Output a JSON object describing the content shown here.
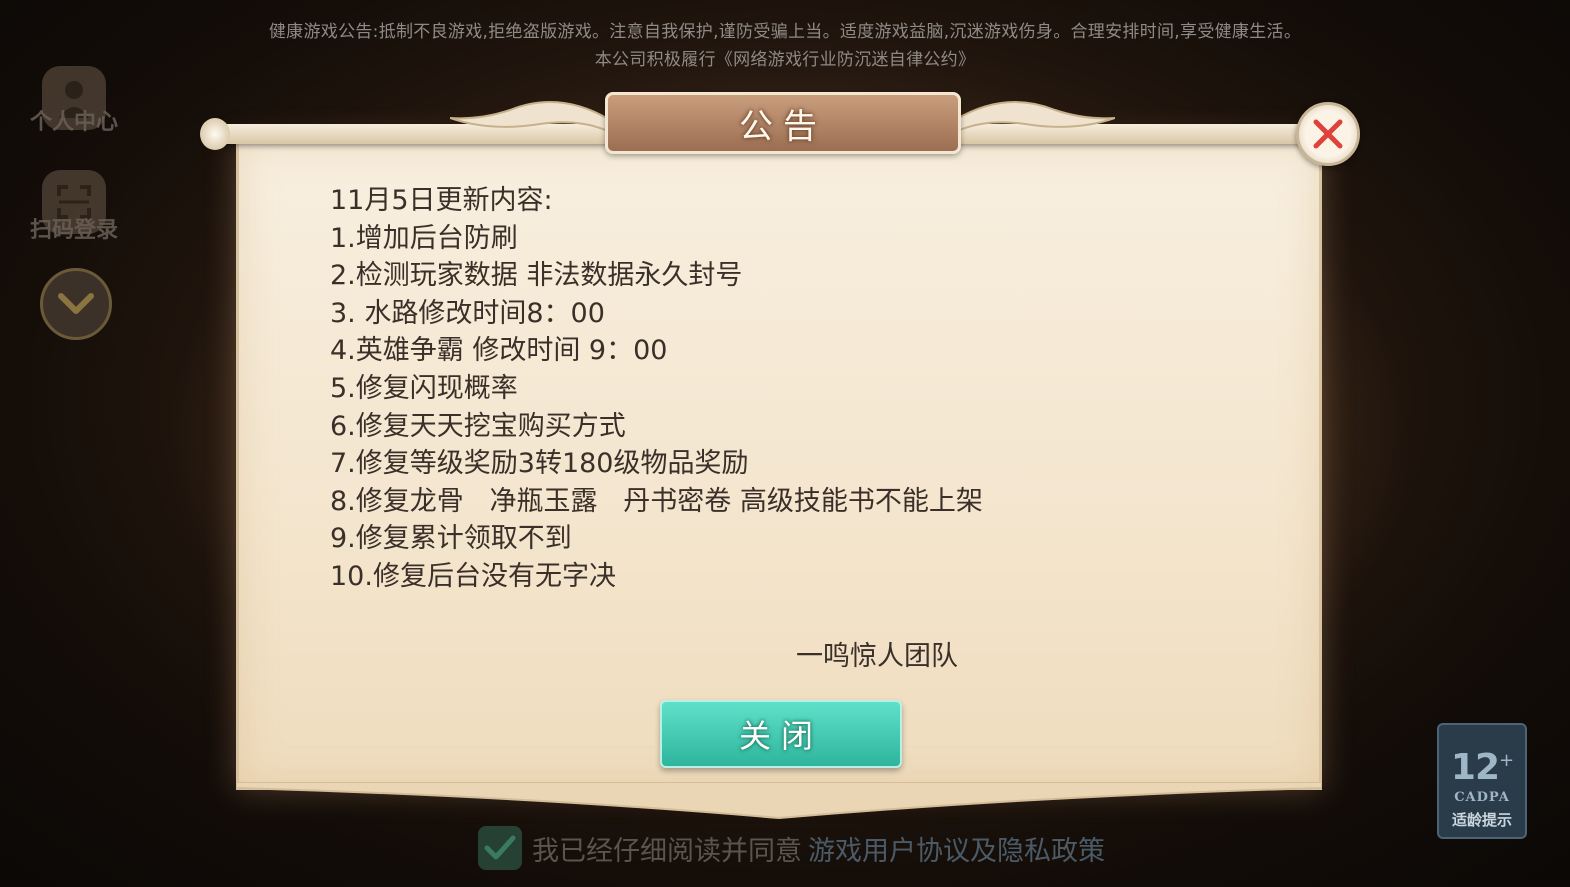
{
  "health_notice": {
    "line1": "健康游戏公告:抵制不良游戏,拒绝盗版游戏。注意自我保护,谨防受骗上当。适度游戏益脑,沉迷游戏伤身。合理安排时间,享受健康生活。",
    "line2": "本公司积极履行《网络游戏行业防沉迷自律公约》"
  },
  "sidebar": {
    "personal_center": "个人中心",
    "scan_login": "扫码登录"
  },
  "dialog": {
    "title": "公告",
    "lines": [
      "11月5日更新内容:",
      "1.增加后台防刷",
      "2.检测玩家数据 非法数据永久封号",
      "3. 水路修改时间8：00",
      "4.英雄争霸 修改时间 9：00",
      "5.修复闪现概率",
      "6.修复天天挖宝购买方式",
      "7.修复等级奖励3转180级物品奖励",
      "8.修复龙骨   净瓶玉露   丹书密卷 高级技能书不能上架",
      "9.修复累计领取不到",
      "10.修复后台没有无字决"
    ],
    "signature": "一鸣惊人团队",
    "close_button": "关闭"
  },
  "agreement": {
    "text": "我已经仔细阅读并同意",
    "link": "游戏用户协议及隐私政策",
    "checked": true
  },
  "age_rating": {
    "number": "12",
    "plus": "+",
    "org": "CADPA",
    "tip": "适龄提示"
  },
  "colors": {
    "accent_teal": "#2fb59d",
    "close_red": "#e0413a",
    "paper": "#f4e6cf"
  }
}
